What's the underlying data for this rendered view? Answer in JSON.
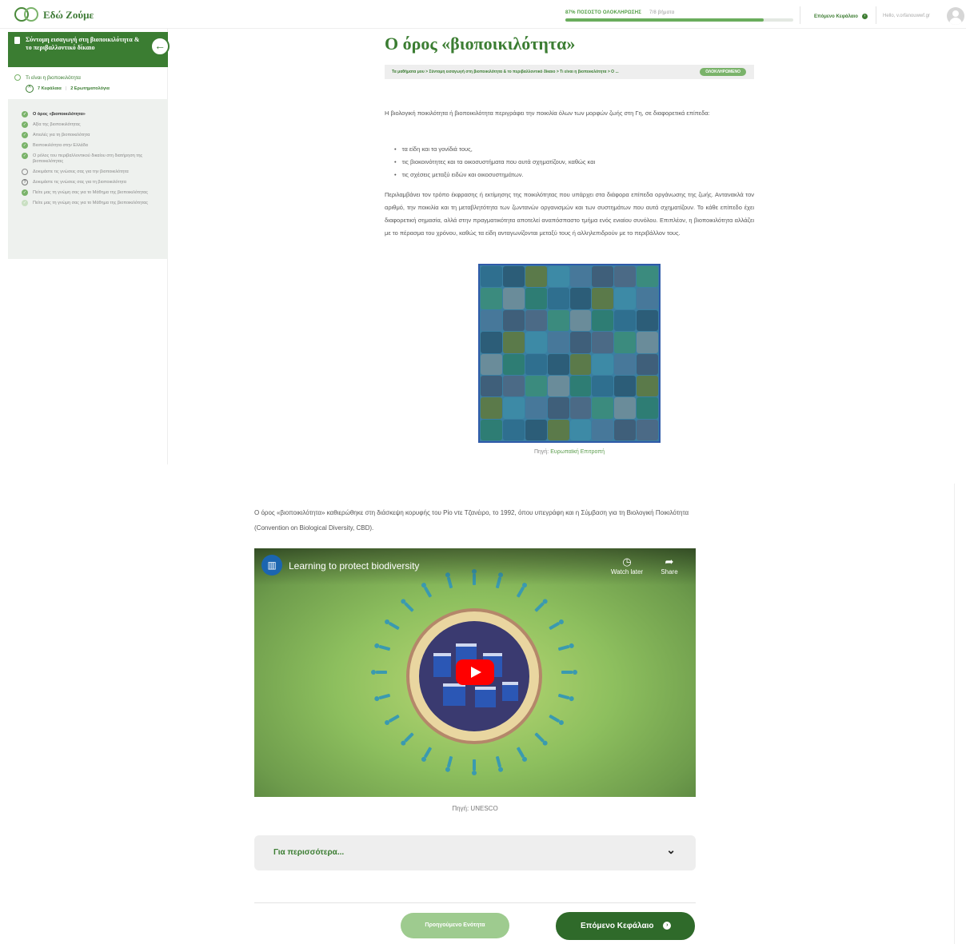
{
  "header": {
    "logo_text": "Εδώ Ζούμε",
    "logo_sub": "",
    "progress_label": "87% ΠΟΣΟΣΤΟ ΟΛΟΚΛΗΡΩΣΗΣ",
    "progress_count": "7/8 βήματα",
    "progress_fraction": 0.87,
    "next_chapter": "Επόμενο Κεφάλαιο",
    "user_greeting": "Hello, v.orfanouwwf.gr"
  },
  "sidebar": {
    "course_title": "Σύντομη εισαγωγή στη βιοποικιλότητα & το περιβαλλοντικό δίκαιο",
    "lesson_title": "Τι είναι η βιοποικιλότητα",
    "lesson_chapters": "7 Κεφάλαια",
    "lesson_quizzes": "2 Ερωτηματολόγια",
    "topics": [
      {
        "label": "Ο όρος «βιοποικιλότητα»",
        "state": "done",
        "current": true
      },
      {
        "label": "Αξία της βιοποικιλότητας",
        "state": "done"
      },
      {
        "label": "Απειλές για τη βιοποικιλότητα",
        "state": "done"
      },
      {
        "label": "Βιοποικιλότητα στην Ελλάδα",
        "state": "done"
      },
      {
        "label": "Ο ρόλος του περιβαλλοντικού δικαίου στη διατήρηση της βιοποικιλότητας",
        "state": "done"
      },
      {
        "label": "Δοκιμάστε τις γνώσεις σας για την βιοποικιλότητα",
        "state": "open"
      },
      {
        "label": "Δοκιμάστε τις γνώσεις σας για τη βιοποικιλότητα",
        "state": "quiz"
      },
      {
        "label": "Πείτε μας τη γνώμη σας για το Μάθημα της βιοποικιλότητας",
        "state": "done"
      },
      {
        "label": "Πείτε μας τη γνώμη σας για το Μάθημα της βιοποικιλότητας",
        "state": "light"
      }
    ]
  },
  "main": {
    "title": "Ο όρος «βιοποικιλότητα»",
    "breadcrumb": "Τα μαθήματα μου > Σύντομη εισαγωγή στη βιοποικιλότητα & το περιβαλλοντικό δίκαιο > Τι είναι η βιοποικιλότητα > Ο ...",
    "status_badge": "ΟΛΟΚΛΗΡΩΜΕΝΟ",
    "intro": "Η βιολογική ποικιλότητα ή βιοποικιλότητα περιγράφει την ποικιλία όλων των μορφών ζωής στη Γη, σε διαφορετικά επίπεδα:",
    "bullets": [
      "τα είδη και τα γονίδιά τους,",
      "τις βιοκοινότητες και τα οικοσυστήματα που αυτά σχηματίζουν, καθώς και",
      "τις σχέσεις μεταξύ ειδών και οικοσυστημάτων."
    ],
    "paragraph2": "Περιλαμβάνει τον τρόπο έκφρασης ή εκτίμησης της ποικιλότητας που υπάρχει στα διάφορα επίπεδα οργάνωσης της ζωής. Αντανακλά τον αριθμό, την ποικιλία και τη μεταβλητότητα των ζωντανών οργανισμών και των συστημάτων που αυτά σχηματίζουν. Το κάθε επίπεδο έχει διαφορετική σημασία, αλλά στην πραγματικότητα αποτελεί αναπόσπαστο τμήμα ενός ενιαίου συνόλου. Επιπλέον, η βιοποικιλότητα αλλάζει με το πέρασμα του χρόνου, καθώς τα είδη ανταγωνίζονται μεταξύ τους ή αλληλεπιδρούν με το περιβάλλον τους.",
    "image_caption_prefix": "Πηγή:",
    "image_caption_source": "Ευρωπαϊκή Επιτροπή",
    "paragraph3": "Ο όρος «βιοποικιλότητα» καθιερώθηκε στη διάσκεψη κορυφής του Ρίο ντε Τζανέιρο, το 1992, όπου υπεγράφη και η Σύμβαση για τη Βιολογική Ποικιλότητα (Convention on Biological Diversity, CBD).",
    "video": {
      "title": "Learning to protect biodiversity",
      "watch_later": "Watch later",
      "share": "Share"
    },
    "video_caption": "Πηγή: UNESCO",
    "accordion_label": "Για περισσότερα...",
    "prev_button": "Προηγούμενο Ενότητα",
    "next_button": "Επόμενο Κεφάλαιο"
  },
  "colors": {
    "brand_green": "#3b7d32",
    "light_green": "#7ab36a",
    "dark_green": "#2f6a2a"
  }
}
